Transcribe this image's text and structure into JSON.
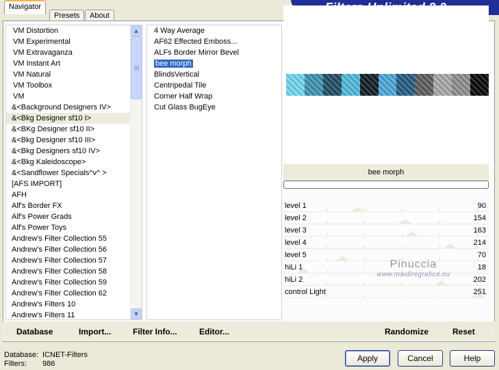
{
  "app": {
    "title": "Filters Unlimited 2.0"
  },
  "tabs": [
    {
      "label": "Navigator"
    },
    {
      "label": "Presets"
    },
    {
      "label": "About"
    }
  ],
  "categories": [
    "VM Distortion",
    "VM Experimental",
    "VM Extravaganza",
    "VM Instant Art",
    "VM Natural",
    "VM Toolbox",
    "VM",
    "&<Background Designers IV>",
    "&<Bkg Designer sf10 I>",
    "&<BKg Designer sf10 II>",
    "&<Bkg Designer sf10 III>",
    "&<Bkg Designers sf10 IV>",
    "&<Bkg Kaleidoscope>",
    "&<Sandflower Specials^v^ >",
    "[AFS IMPORT]",
    "AFH",
    "Alf's Border FX",
    "Alf's Power Grads",
    "Alf's Power Toys",
    "Andrew's Filter Collection 55",
    "Andrew's Filter Collection 56",
    "Andrew's Filter Collection 57",
    "Andrew's Filter Collection 58",
    "Andrew's Filter Collection 59",
    "Andrew's Filter Collection 62",
    "Andrew's Filters 10",
    "Andrew's Filters 11"
  ],
  "filters": [
    "4 Way Average",
    "AF62 Effected Emboss...",
    "ALFs Border Mirror Bevel",
    "bee morph",
    "BlindsVertical",
    "Centripedal Tile",
    "Corner Half Wrap",
    "Cut Glass  BugEye"
  ],
  "selected_filter": "bee morph",
  "preview": {
    "strip_colors": [
      "#6fd6f0",
      "#3c8fb0",
      "#1e4a63",
      "#4fb7dc",
      "#0d1a24",
      "#4aa6d6",
      "#1f5a80",
      "#5b5b5b",
      "#a7a7a7",
      "#8c8c8c",
      "#050505"
    ]
  },
  "params": [
    {
      "label": "level 1",
      "value": "90",
      "level": 90
    },
    {
      "label": "level 2",
      "value": "154",
      "level": 154
    },
    {
      "label": "level 3",
      "value": "163",
      "level": 163
    },
    {
      "label": "level 4",
      "value": "214",
      "level": 214
    },
    {
      "label": "level 5",
      "value": "70",
      "level": 70
    },
    {
      "label": "hiLi 1",
      "value": "18",
      "level": 18
    },
    {
      "label": "hiLi 2",
      "value": "202",
      "level": 202
    },
    {
      "label": "control Light",
      "value": "251",
      "level": 251
    }
  ],
  "watermark": {
    "name": "Pinuccia",
    "url": "www.maidiregrafica.eu"
  },
  "bottom_buttons": {
    "database": "Database",
    "import": "Import...",
    "filter_info": "Filter Info...",
    "editor": "Editor...",
    "randomize": "Randomize",
    "reset": "Reset"
  },
  "status": {
    "database_label": "Database:",
    "database_value": "ICNET-Filters",
    "filters_label": "Filters:",
    "filters_value": "986"
  },
  "dialog_buttons": {
    "apply": "Apply",
    "cancel": "Cancel",
    "help": "Help"
  }
}
